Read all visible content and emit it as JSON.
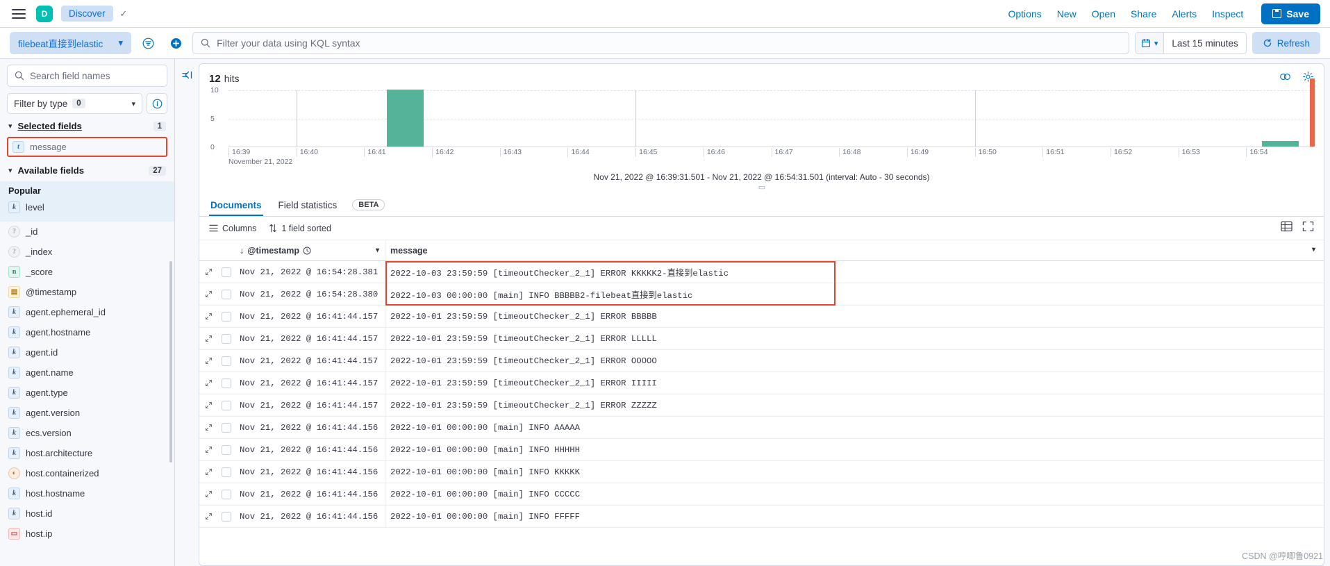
{
  "top_nav": {
    "menu_icon": "hamburger-icon",
    "app_badge": "D",
    "breadcrumb": "Discover",
    "links": [
      "Options",
      "New",
      "Open",
      "Share",
      "Alerts",
      "Inspect"
    ],
    "save_label": "Save"
  },
  "query_bar": {
    "data_view": "filebeat直接到elastic",
    "kql_placeholder": "Filter your data using KQL syntax",
    "kql_value": "",
    "time_range": "Last 15 minutes",
    "refresh_label": "Refresh"
  },
  "sidebar": {
    "search_placeholder": "Search field names",
    "filter_by_type_label": "Filter by type",
    "filter_by_type_count": "0",
    "selected_fields_label": "Selected fields",
    "selected_fields_count": "1",
    "selected_fields": [
      {
        "name": "message",
        "type": "t"
      }
    ],
    "available_fields_label": "Available fields",
    "available_fields_count": "27",
    "popular_label": "Popular",
    "popular_fields": [
      {
        "name": "level",
        "type": "k"
      }
    ],
    "available_fields": [
      {
        "name": "_id",
        "type": "q"
      },
      {
        "name": "_index",
        "type": "q"
      },
      {
        "name": "_score",
        "type": "n"
      },
      {
        "name": "@timestamp",
        "type": "d"
      },
      {
        "name": "agent.ephemeral_id",
        "type": "k"
      },
      {
        "name": "agent.hostname",
        "type": "k"
      },
      {
        "name": "agent.id",
        "type": "k"
      },
      {
        "name": "agent.name",
        "type": "k"
      },
      {
        "name": "agent.type",
        "type": "k"
      },
      {
        "name": "agent.version",
        "type": "k"
      },
      {
        "name": "ecs.version",
        "type": "k"
      },
      {
        "name": "host.architecture",
        "type": "k"
      },
      {
        "name": "host.containerized",
        "type": "b"
      },
      {
        "name": "host.hostname",
        "type": "k"
      },
      {
        "name": "host.id",
        "type": "k"
      },
      {
        "name": "host.ip",
        "type": "ip"
      }
    ]
  },
  "main": {
    "hits_count": "12",
    "hits_label": "hits",
    "chart_subtitle": "Nov 21, 2022 @ 16:39:31.501 - Nov 21, 2022 @ 16:54:31.501 (interval: Auto - 30 seconds)",
    "tabs": [
      {
        "label": "Documents",
        "active": true
      },
      {
        "label": "Field statistics",
        "active": false
      }
    ],
    "beta_label": "BETA",
    "toolbar": {
      "columns_label": "Columns",
      "sort_label": "1 field sorted"
    },
    "table": {
      "columns": [
        "@timestamp",
        "message"
      ],
      "rows": [
        {
          "timestamp": "Nov 21, 2022 @ 16:54:28.381",
          "message": "2022-10-03 23:59:59 [timeoutChecker_2_1] ERROR KKKKK2-直接到elastic"
        },
        {
          "timestamp": "Nov 21, 2022 @ 16:54:28.380",
          "message": "2022-10-03 00:00:00 [main] INFO BBBBB2-filebeat直接到elastic"
        },
        {
          "timestamp": "Nov 21, 2022 @ 16:41:44.157",
          "message": "2022-10-01 23:59:59 [timeoutChecker_2_1] ERROR BBBBB"
        },
        {
          "timestamp": "Nov 21, 2022 @ 16:41:44.157",
          "message": "2022-10-01 23:59:59 [timeoutChecker_2_1] ERROR LLLLL"
        },
        {
          "timestamp": "Nov 21, 2022 @ 16:41:44.157",
          "message": "2022-10-01 23:59:59 [timeoutChecker_2_1] ERROR OOOOO"
        },
        {
          "timestamp": "Nov 21, 2022 @ 16:41:44.157",
          "message": "2022-10-01 23:59:59 [timeoutChecker_2_1] ERROR IIIII"
        },
        {
          "timestamp": "Nov 21, 2022 @ 16:41:44.157",
          "message": "2022-10-01 23:59:59 [timeoutChecker_2_1] ERROR ZZZZZ"
        },
        {
          "timestamp": "Nov 21, 2022 @ 16:41:44.156",
          "message": "2022-10-01 00:00:00 [main] INFO AAAAA"
        },
        {
          "timestamp": "Nov 21, 2022 @ 16:41:44.156",
          "message": "2022-10-01 00:00:00 [main] INFO HHHHH"
        },
        {
          "timestamp": "Nov 21, 2022 @ 16:41:44.156",
          "message": "2022-10-01 00:00:00 [main] INFO KKKKK"
        },
        {
          "timestamp": "Nov 21, 2022 @ 16:41:44.156",
          "message": "2022-10-01 00:00:00 [main] INFO CCCCC"
        },
        {
          "timestamp": "Nov 21, 2022 @ 16:41:44.156",
          "message": "2022-10-01 00:00:00 [main] INFO FFFFF"
        }
      ]
    }
  },
  "watermark": "CSDN @哼唧鲁0921",
  "colors": {
    "accent": "#0071c2",
    "bar": "#54b399",
    "highlight": "#e7452a",
    "brand": "#00bfb3"
  },
  "chart_data": {
    "type": "bar",
    "title": "",
    "xlabel": "November 21, 2022",
    "ylabel": "",
    "ylim": [
      0,
      10
    ],
    "yticks": [
      0,
      5,
      10
    ],
    "grid": true,
    "categories": [
      "16:39",
      "16:40",
      "16:41",
      "16:42",
      "16:43",
      "16:44",
      "16:45",
      "16:46",
      "16:47",
      "16:48",
      "16:49",
      "16:50",
      "16:51",
      "16:52",
      "16:53",
      "16:54"
    ],
    "bars": [
      {
        "time": "16:41:30",
        "value": 10
      },
      {
        "time": "16:54:00",
        "value": 1
      },
      {
        "time": "16:54:30",
        "value": 1
      }
    ]
  }
}
